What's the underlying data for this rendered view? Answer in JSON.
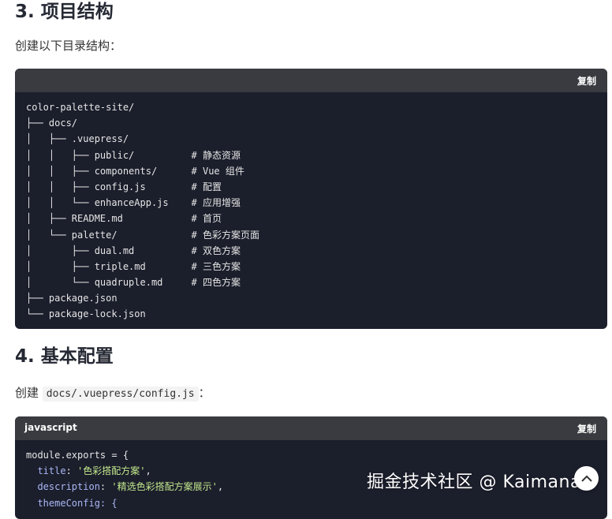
{
  "section3": {
    "title": "3. 项目结构",
    "intro": "创建以下目录结构："
  },
  "codeblock1": {
    "copy_label": "复制",
    "lines": [
      "color-palette-site/",
      "├── docs/",
      "│   ├── .vuepress/",
      "│   │   ├── public/          # 静态资源",
      "│   │   ├── components/      # Vue 组件",
      "│   │   ├── config.js        # 配置",
      "│   │   └── enhanceApp.js    # 应用增强",
      "│   ├── README.md            # 首页",
      "│   └── palette/             # 色彩方案页面",
      "│       ├── dual.md          # 双色方案",
      "│       ├── triple.md        # 三色方案",
      "│       └── quadruple.md     # 四色方案",
      "├── package.json",
      "└── package-lock.json"
    ]
  },
  "section4": {
    "title": "4. 基本配置",
    "intro_prefix": "创建",
    "intro_code": "docs/.vuepress/config.js",
    "intro_suffix": "："
  },
  "codeblock2": {
    "language": "javascript",
    "copy_label": "复制",
    "line1": "module.exports = {",
    "line2_key": "  title",
    "line2_sep": ": ",
    "line2_val": "'色彩搭配方案'",
    "line2_end": ",",
    "line3_key": "  description",
    "line3_sep": ": ",
    "line3_val": "'精选色彩搭配方案展示'",
    "line3_end": ",",
    "line4": "  themeConfig: {"
  },
  "watermark": "掘金技术社区 @ Kaimana",
  "colors": {
    "code_bg": "#1b1e2b",
    "code_header_bg": "#3a3b40",
    "string": "#c3e88d",
    "key": "#a9b7f5"
  }
}
